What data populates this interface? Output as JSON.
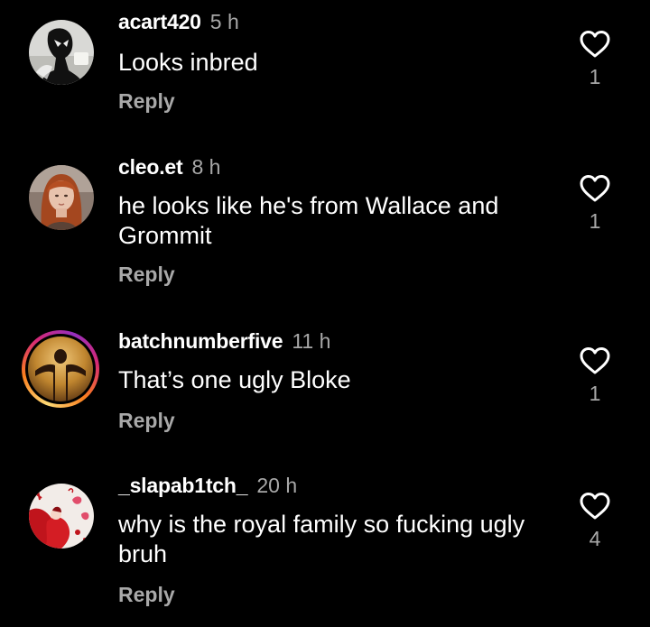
{
  "comments": [
    {
      "username": "acart420",
      "time": "5 h",
      "text": "Looks inbred",
      "reply": "Reply",
      "likes": "1",
      "avatar": "spiderman-avatar",
      "has_story": false
    },
    {
      "username": "cleo.et",
      "time": "8 h",
      "text": "he looks like he's from Wallace and Grommit",
      "reply": "Reply",
      "likes": "1",
      "avatar": "redhead-woman-avatar",
      "has_story": false
    },
    {
      "username": "batchnumberfive",
      "time": "11 h",
      "text": "That’s one ugly Bloke",
      "reply": "Reply",
      "likes": "1",
      "avatar": "silhouette-avatar",
      "has_story": true
    },
    {
      "username": "_slapab1tch_",
      "time": "20 h",
      "text": "why is the royal family so fucking ugly bruh",
      "reply": "Reply",
      "likes": "4",
      "avatar": "red-illustration-avatar",
      "has_story": false
    }
  ],
  "colors": {
    "background": "#000000",
    "primary_text": "#ffffff",
    "secondary_text": "#a8a8a8",
    "story_ring": [
      "#feda75",
      "#fa7e1e",
      "#d62976",
      "#962fbf"
    ]
  },
  "icons": {
    "like": "heart-outline-icon"
  }
}
